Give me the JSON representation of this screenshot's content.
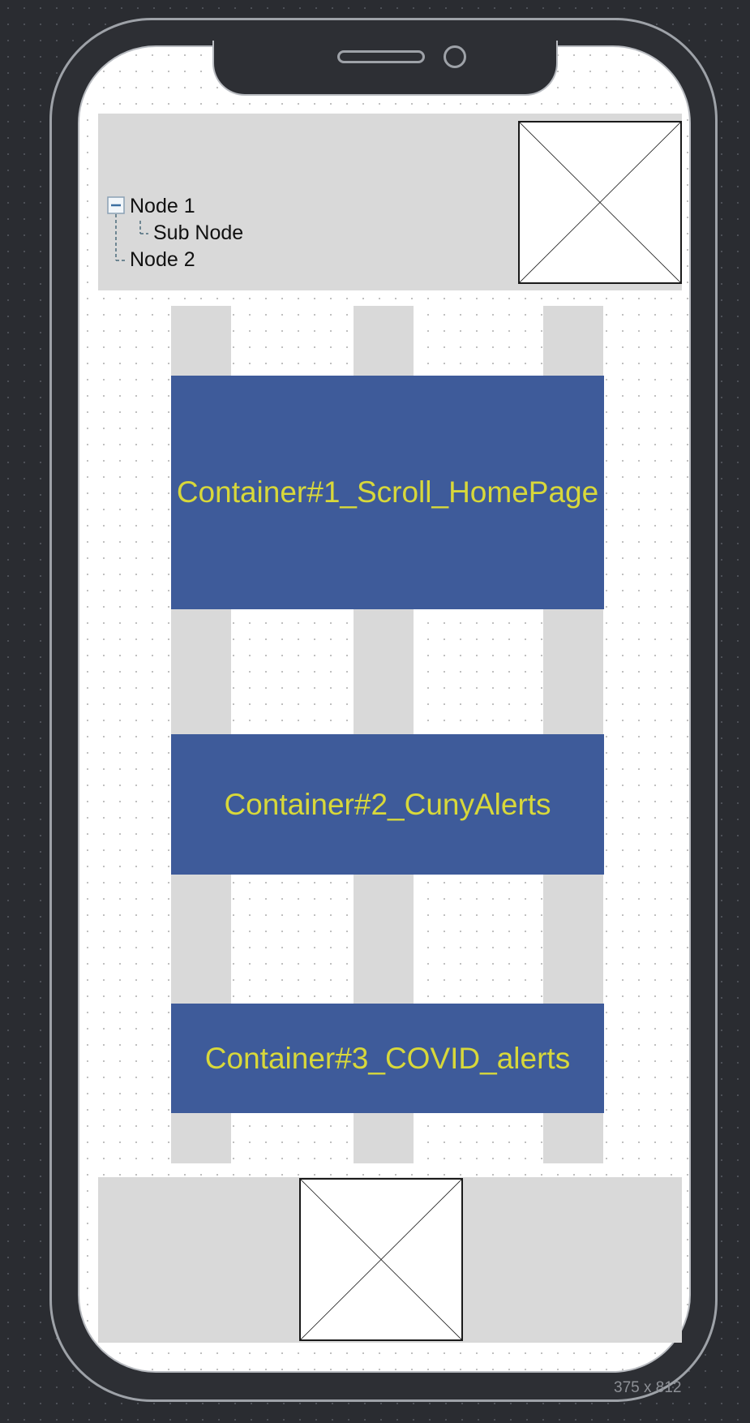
{
  "tree": {
    "nodes": [
      {
        "label": "Node 1",
        "expanded": true,
        "children": [
          {
            "label": "Sub Node"
          }
        ]
      },
      {
        "label": "Node 2"
      }
    ]
  },
  "containers": [
    {
      "label": "Container#1_Scroll_HomePage"
    },
    {
      "label": "Container#2_CunyAlerts"
    },
    {
      "label": "Container#3_COVID_alerts"
    }
  ],
  "canvas": {
    "size_label": "375 x 812"
  },
  "colors": {
    "container_fill": "#3e5b9a",
    "container_text": "#d8d83a",
    "bar_fill": "#d9d9d9"
  },
  "icons": [
    "collapse-minus-icon",
    "image-placeholder-icon"
  ]
}
